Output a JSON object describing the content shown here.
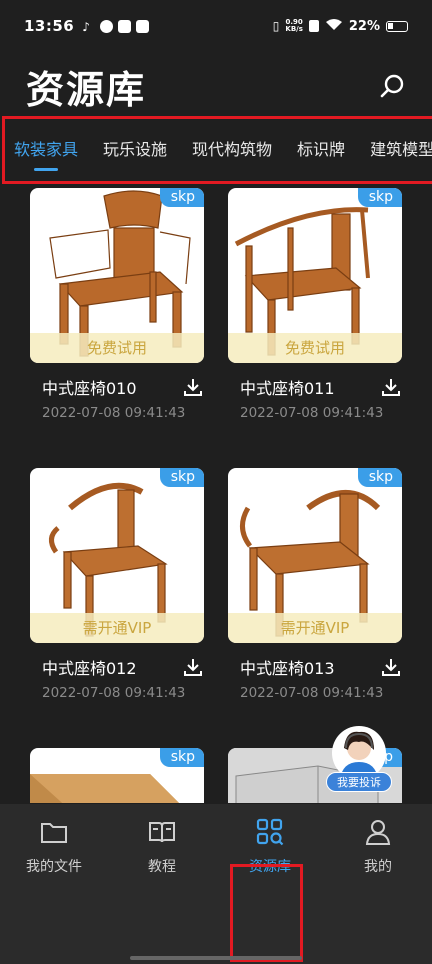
{
  "status_bar": {
    "time": "13:56",
    "net_speed_top": "0.90",
    "net_speed_bottom": "KB/s",
    "battery": "22%"
  },
  "header": {
    "title": "资源库",
    "search_icon": "search-icon"
  },
  "tabs": [
    {
      "label": "软装家具",
      "active": true
    },
    {
      "label": "玩乐设施",
      "active": false
    },
    {
      "label": "现代构筑物",
      "active": false
    },
    {
      "label": "标识牌",
      "active": false
    },
    {
      "label": "建筑模型",
      "active": false
    }
  ],
  "items": [
    {
      "badge": "skp",
      "access": "免费试用",
      "name": "中式座椅010",
      "date": "2022-07-08 09:41:43"
    },
    {
      "badge": "skp",
      "access": "免费试用",
      "name": "中式座椅011",
      "date": "2022-07-08 09:41:43"
    },
    {
      "badge": "skp",
      "access": "需开通VIP",
      "name": "中式座椅012",
      "date": "2022-07-08 09:41:43"
    },
    {
      "badge": "skp",
      "access": "需开通VIP",
      "name": "中式座椅013",
      "date": "2022-07-08 09:41:43"
    },
    {
      "badge": "skp",
      "access": "",
      "name": "",
      "date": ""
    },
    {
      "badge": "skp",
      "access": "",
      "name": "",
      "date": ""
    }
  ],
  "complaint": {
    "label": "我要投诉"
  },
  "bottom_nav": [
    {
      "label": "我的文件",
      "icon": "folder-icon",
      "active": false
    },
    {
      "label": "教程",
      "icon": "book-icon",
      "active": false
    },
    {
      "label": "资源库",
      "icon": "grid-search-icon",
      "active": true
    },
    {
      "label": "我的",
      "icon": "person-icon",
      "active": false
    }
  ],
  "colors": {
    "accent": "#41a4ee",
    "highlight_border": "#e21a22",
    "badge": "#3b9ee8",
    "background": "#1f1f1f"
  }
}
